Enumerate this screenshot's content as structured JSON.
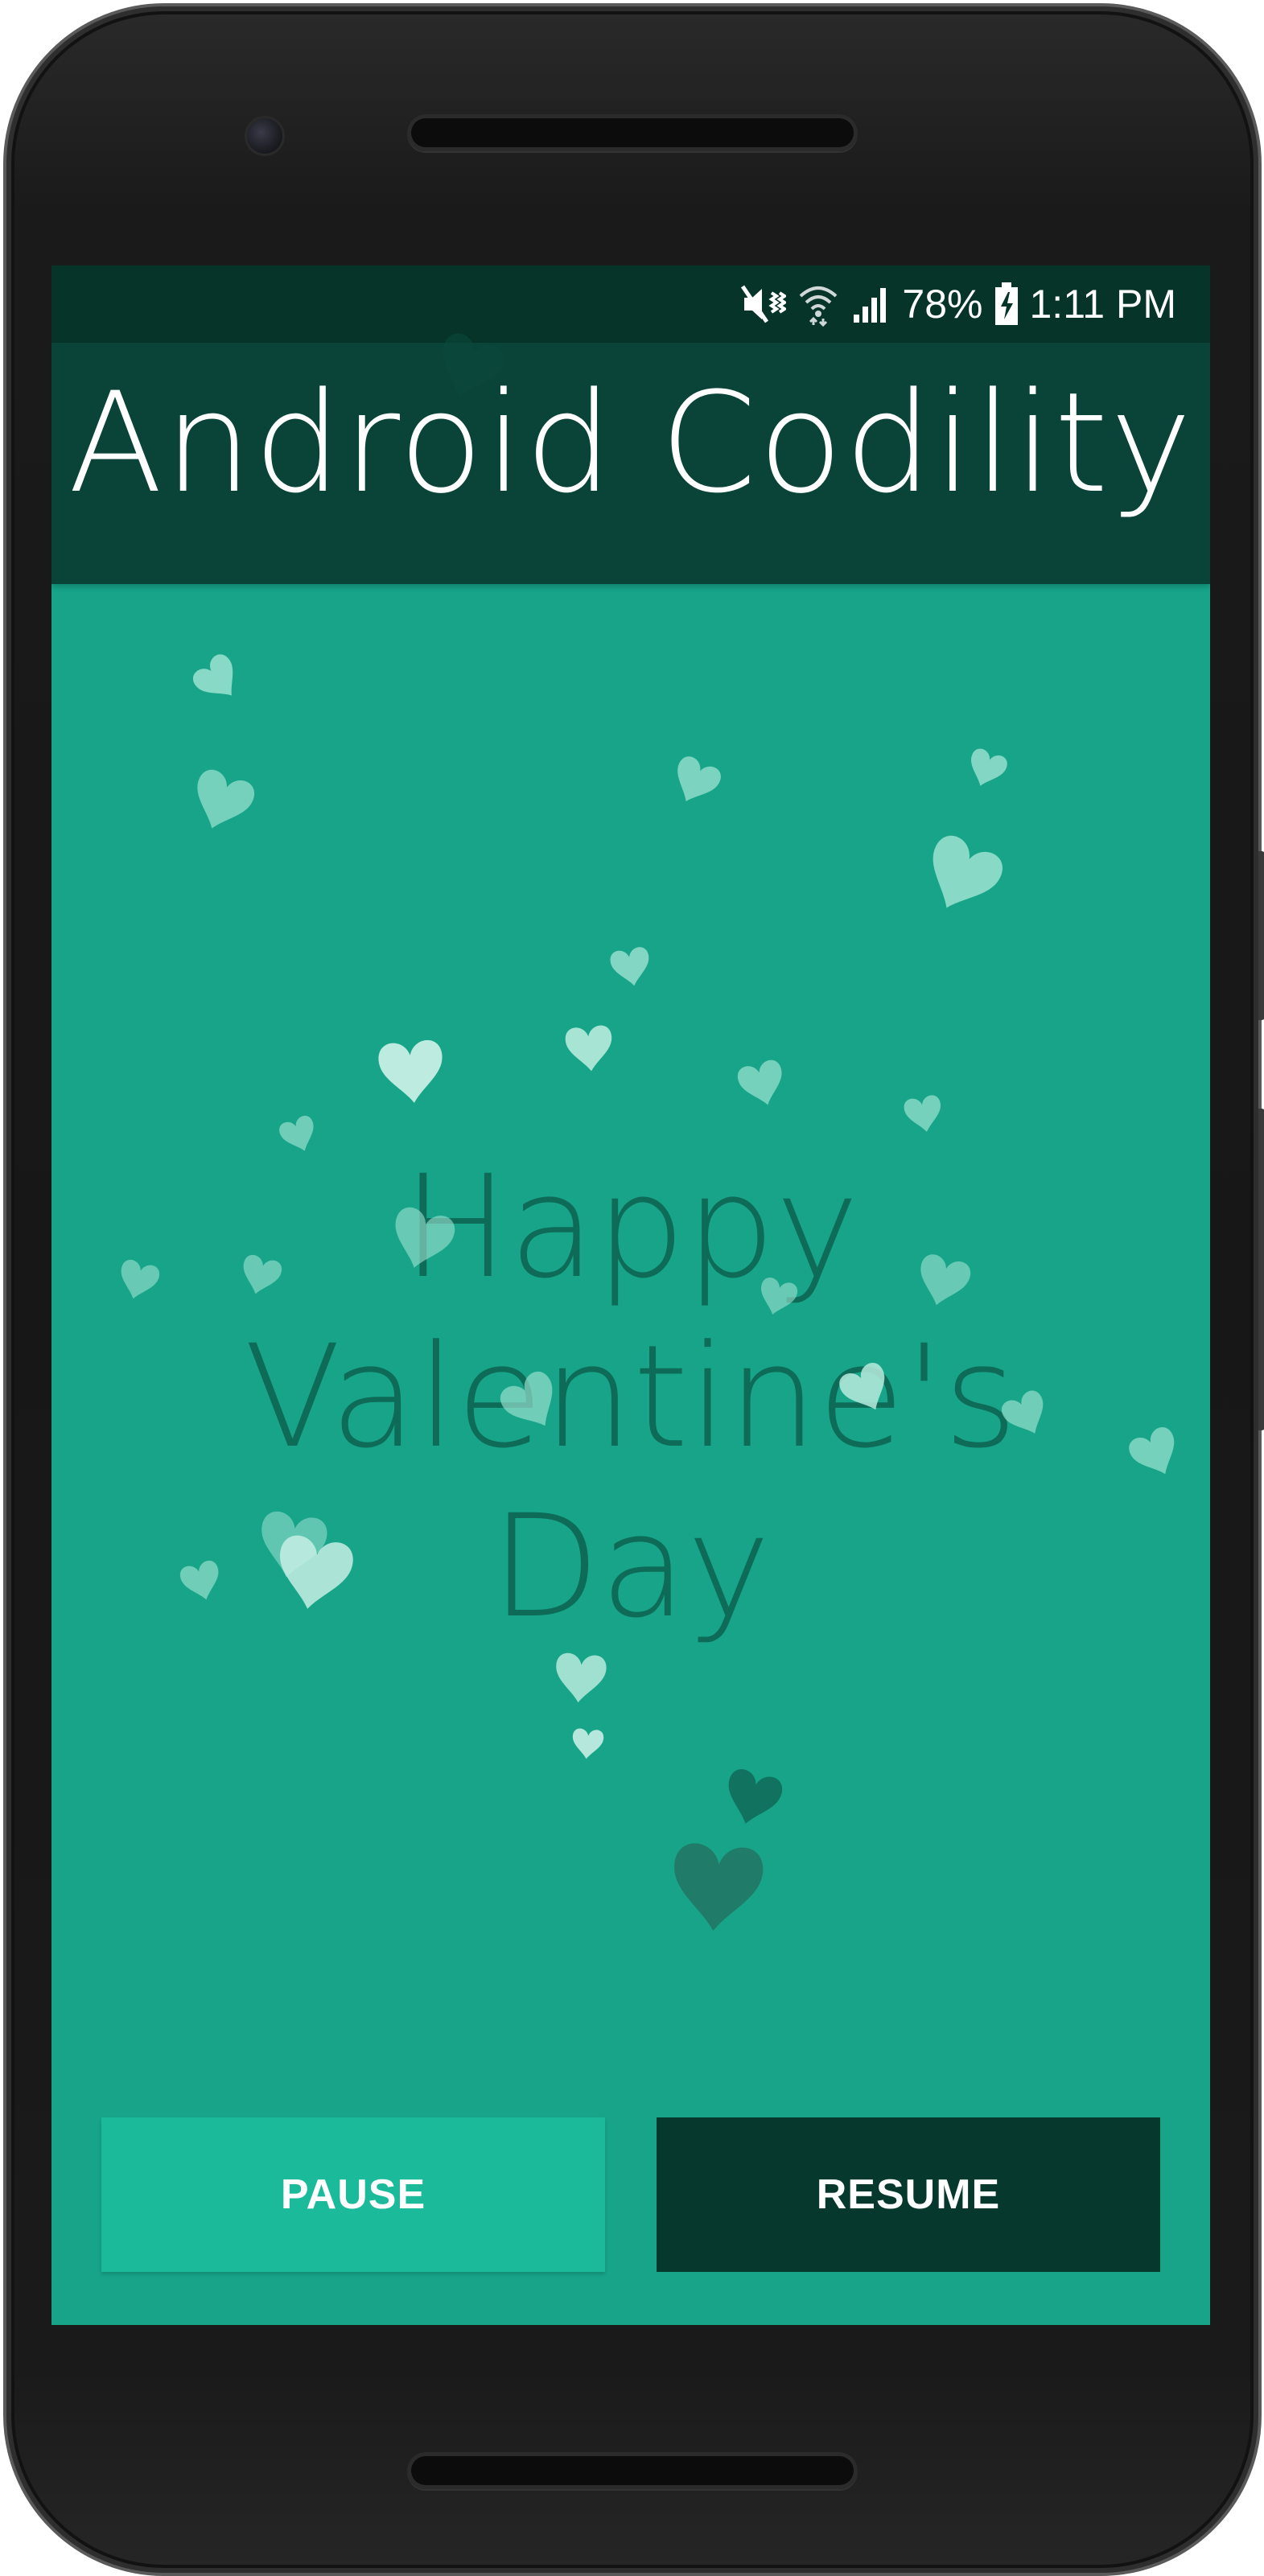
{
  "status_bar": {
    "battery": "78%",
    "time": "1:11 PM",
    "icons": [
      "mute-vibrate-icon",
      "wifi-icon",
      "signal-icon",
      "battery-charging-icon"
    ]
  },
  "app_bar": {
    "title": "Android Codility"
  },
  "main": {
    "greeting": "Happy Valentine's Day"
  },
  "buttons": {
    "pause_label": "PAUSE",
    "resume_label": "RESUME"
  },
  "colors": {
    "status_bar": "#063429",
    "app_bar": "#0a4337",
    "background": "#17a489",
    "greeting_text": "#0e6b58",
    "pause_button": "#1bba9a",
    "resume_button": "#06382d",
    "heart_light": "#9ee3d2",
    "heart_dark": "#0b4a3d"
  },
  "decorations": {
    "icon": "heart-icon",
    "description_count_visible": 28
  }
}
